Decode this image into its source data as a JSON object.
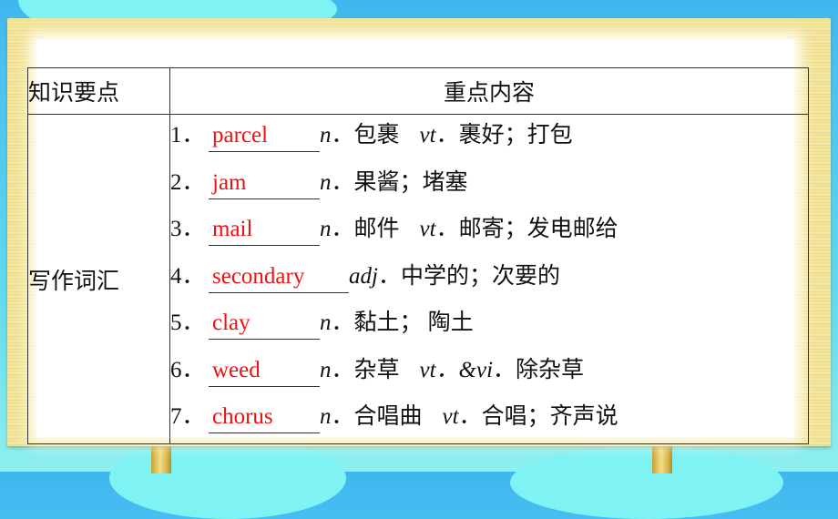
{
  "table": {
    "headers": [
      "知识要点",
      "重点内容"
    ],
    "topic": "写作词汇",
    "items": [
      {
        "num": "1．",
        "answer": "parcel",
        "pos1": "n",
        "meaning1": "．包裹",
        "pos2": "vt",
        "meaning2": "．裹好；打包"
      },
      {
        "num": "2．",
        "answer": "jam",
        "pos1": "n",
        "meaning1": "．果酱；堵塞",
        "pos2": "",
        "meaning2": ""
      },
      {
        "num": "3．",
        "answer": "mail",
        "pos1": "n",
        "meaning1": "．邮件",
        "pos2": "vt",
        "meaning2": "．邮寄；发电邮给"
      },
      {
        "num": "4．",
        "answer": "secondary",
        "pos1": "adj",
        "meaning1": "．中学的；次要的",
        "pos2": "",
        "meaning2": ""
      },
      {
        "num": "5．",
        "answer": "clay",
        "pos1": "n",
        "meaning1": "．黏土； 陶土",
        "pos2": "",
        "meaning2": ""
      },
      {
        "num": "6．",
        "answer": "weed",
        "pos1": "n",
        "meaning1": "．杂草",
        "pos2": "vt．&vi",
        "meaning2": "．除杂草"
      },
      {
        "num": "7．",
        "answer": "chorus",
        "pos1": "n",
        "meaning1": "．合唱曲",
        "pos2": "vt",
        "meaning2": "．合唱；齐声说"
      }
    ]
  },
  "colors": {
    "answer": "#ee1111",
    "text": "#111111",
    "sky": "#49c0f2",
    "board": "#efe08e"
  }
}
